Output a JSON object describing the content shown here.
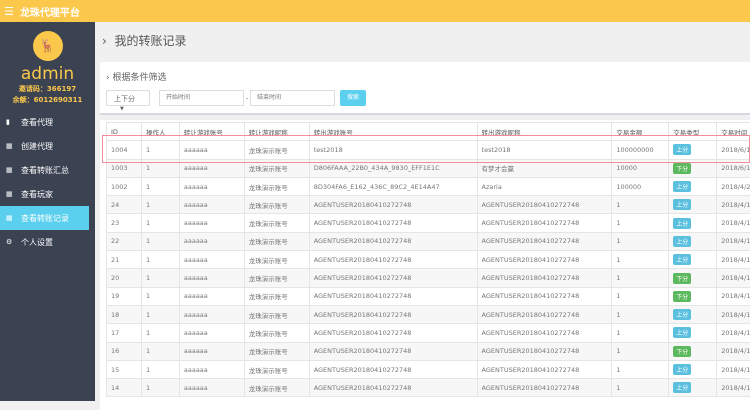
{
  "header": {
    "title": "龙珠代理平台",
    "menu_icon": "hamburger-icon"
  },
  "sidebar": {
    "username": "admin",
    "invite_code": "邀请码：366197",
    "balance": "余额：6012690311",
    "items": [
      {
        "label": "查看代理",
        "icon": "book-icon"
      },
      {
        "label": "创建代理",
        "icon": "table-icon"
      },
      {
        "label": "查看转账汇总",
        "icon": "table-icon"
      },
      {
        "label": "查看玩家",
        "icon": "table-icon"
      },
      {
        "label": "查看转账记录",
        "icon": "table-icon",
        "active": true
      },
      {
        "label": "个人设置",
        "icon": "gears-icon"
      }
    ]
  },
  "page": {
    "title": "我的转账记录"
  },
  "filter": {
    "title": "根据条件筛选",
    "type_select": "上下分",
    "start_placeholder": "开始时间",
    "end_placeholder": "结束时间",
    "separator": "-",
    "search_label": "搜索"
  },
  "colors": {
    "up": "#5bc0de",
    "down": "#5cb85c",
    "accent": "#fcc84c"
  },
  "table": {
    "headers": [
      "ID",
      "操作人",
      "转让游戏账号",
      "转让游戏昵称",
      "转出游戏账号",
      "转出游戏昵称",
      "交易金额",
      "交易类型",
      "交易时间"
    ],
    "rows": [
      [
        "1004",
        "1",
        "aaaaaa",
        "龙珠演示账号",
        "test2018",
        "test2018",
        "100000000",
        "上分",
        "2018/6/1"
      ],
      [
        "1003",
        "1",
        "aaaaaa",
        "龙珠演示账号",
        "D806FAAA_22B0_434A_9830_EFF1E1C",
        "有梦才会赢",
        "10000",
        "下分",
        "2018/6/1"
      ],
      [
        "1002",
        "1",
        "aaaaaa",
        "龙珠演示账号",
        "8D304FA6_E162_436C_89C2_4E14A47",
        "Azaria",
        "100000",
        "上分",
        "2018/4/2"
      ],
      [
        "24",
        "1",
        "aaaaaa",
        "龙珠演示账号",
        "AGENTUSER20180410272748",
        "AGENTUSER20180410272748",
        "1",
        "上分",
        "2018/4/1"
      ],
      [
        "23",
        "1",
        "aaaaaa",
        "龙珠演示账号",
        "AGENTUSER20180410272748",
        "AGENTUSER20180410272748",
        "1",
        "上分",
        "2018/4/1"
      ],
      [
        "22",
        "1",
        "aaaaaa",
        "龙珠演示账号",
        "AGENTUSER20180410272748",
        "AGENTUSER20180410272748",
        "1",
        "上分",
        "2018/4/1"
      ],
      [
        "21",
        "1",
        "aaaaaa",
        "龙珠演示账号",
        "AGENTUSER20180410272748",
        "AGENTUSER20180410272748",
        "1",
        "上分",
        "2018/4/1"
      ],
      [
        "20",
        "1",
        "aaaaaa",
        "龙珠演示账号",
        "AGENTUSER20180410272748",
        "AGENTUSER20180410272748",
        "1",
        "下分",
        "2018/4/1"
      ],
      [
        "19",
        "1",
        "aaaaaa",
        "龙珠演示账号",
        "AGENTUSER20180410272748",
        "AGENTUSER20180410272748",
        "1",
        "下分",
        "2018/4/1"
      ],
      [
        "18",
        "1",
        "aaaaaa",
        "龙珠演示账号",
        "AGENTUSER20180410272748",
        "AGENTUSER20180410272748",
        "1",
        "上分",
        "2018/4/1"
      ],
      [
        "17",
        "1",
        "aaaaaa",
        "龙珠演示账号",
        "AGENTUSER20180410272748",
        "AGENTUSER20180410272748",
        "1",
        "上分",
        "2018/4/1"
      ],
      [
        "16",
        "1",
        "aaaaaa",
        "龙珠演示账号",
        "AGENTUSER20180410272748",
        "AGENTUSER20180410272748",
        "1",
        "下分",
        "2018/4/1"
      ],
      [
        "15",
        "1",
        "aaaaaa",
        "龙珠演示账号",
        "AGENTUSER20180410272748",
        "AGENTUSER20180410272748",
        "1",
        "上分",
        "2018/4/1"
      ],
      [
        "14",
        "1",
        "aaaaaa",
        "龙珠演示账号",
        "AGENTUSER20180410272748",
        "AGENTUSER20180410272748",
        "1",
        "上分",
        "2018/4/1"
      ]
    ]
  }
}
